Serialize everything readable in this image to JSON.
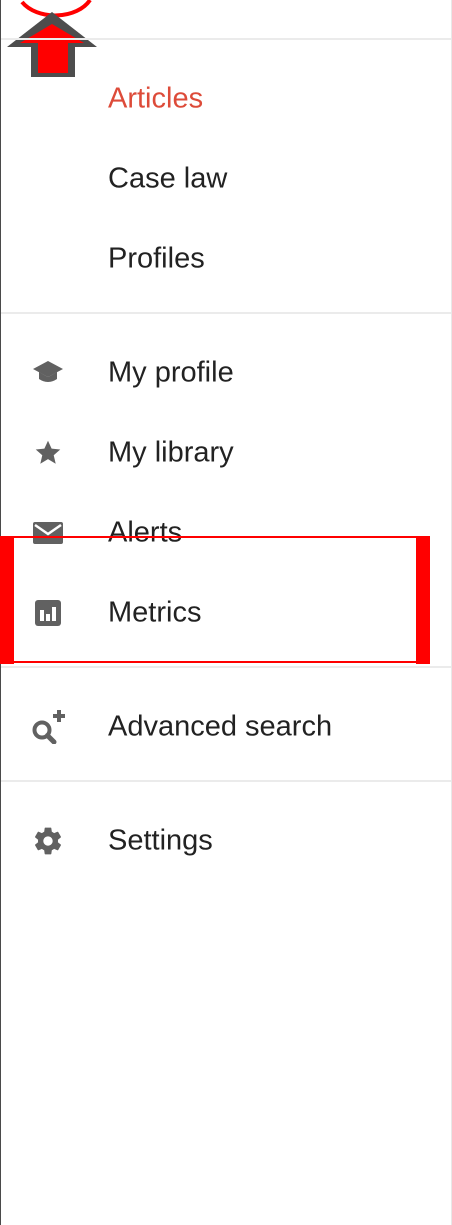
{
  "menu": {
    "sections": {
      "search_scope": [
        {
          "label": "Articles",
          "active": true
        },
        {
          "label": "Case law",
          "active": false
        },
        {
          "label": "Profiles",
          "active": false
        }
      ],
      "personal": [
        {
          "label": "My profile",
          "icon": "graduation-cap-icon"
        },
        {
          "label": "My library",
          "icon": "star-icon"
        },
        {
          "label": "Alerts",
          "icon": "envelope-icon"
        },
        {
          "label": "Metrics",
          "icon": "bar-chart-icon"
        }
      ],
      "search_tools": [
        {
          "label": "Advanced search",
          "icon": "search-plus-icon"
        }
      ],
      "preferences": [
        {
          "label": "Settings",
          "icon": "gear-icon"
        }
      ]
    }
  },
  "colors": {
    "active_link": "#dd4b39",
    "text": "#222222",
    "icon": "#616161",
    "divider": "#ebebeb",
    "annotation_red": "#ff0000",
    "annotation_gray": "#4d4d4d"
  },
  "annotations": {
    "highlighted_item": "Metrics",
    "arrow_direction": "up"
  }
}
